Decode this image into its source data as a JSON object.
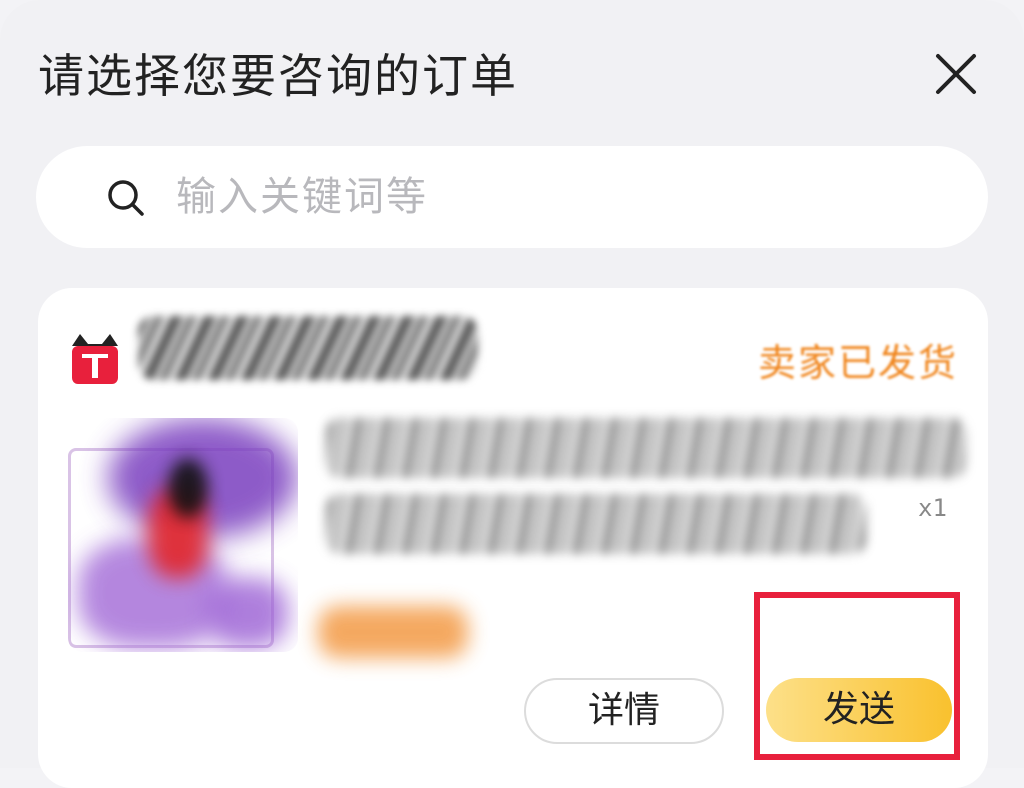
{
  "dialog": {
    "title": "请选择您要咨询的订单"
  },
  "search": {
    "placeholder": "输入关键词等",
    "value": ""
  },
  "order": {
    "shop_logo_icon": "tmall-cat-icon",
    "status": "卖家已发货",
    "quantity": "x1",
    "buttons": {
      "detail": "详情",
      "send": "发送"
    }
  },
  "colors": {
    "status": "#f0861e",
    "send_button": "#f9c12e",
    "highlight": "#e8203c"
  }
}
